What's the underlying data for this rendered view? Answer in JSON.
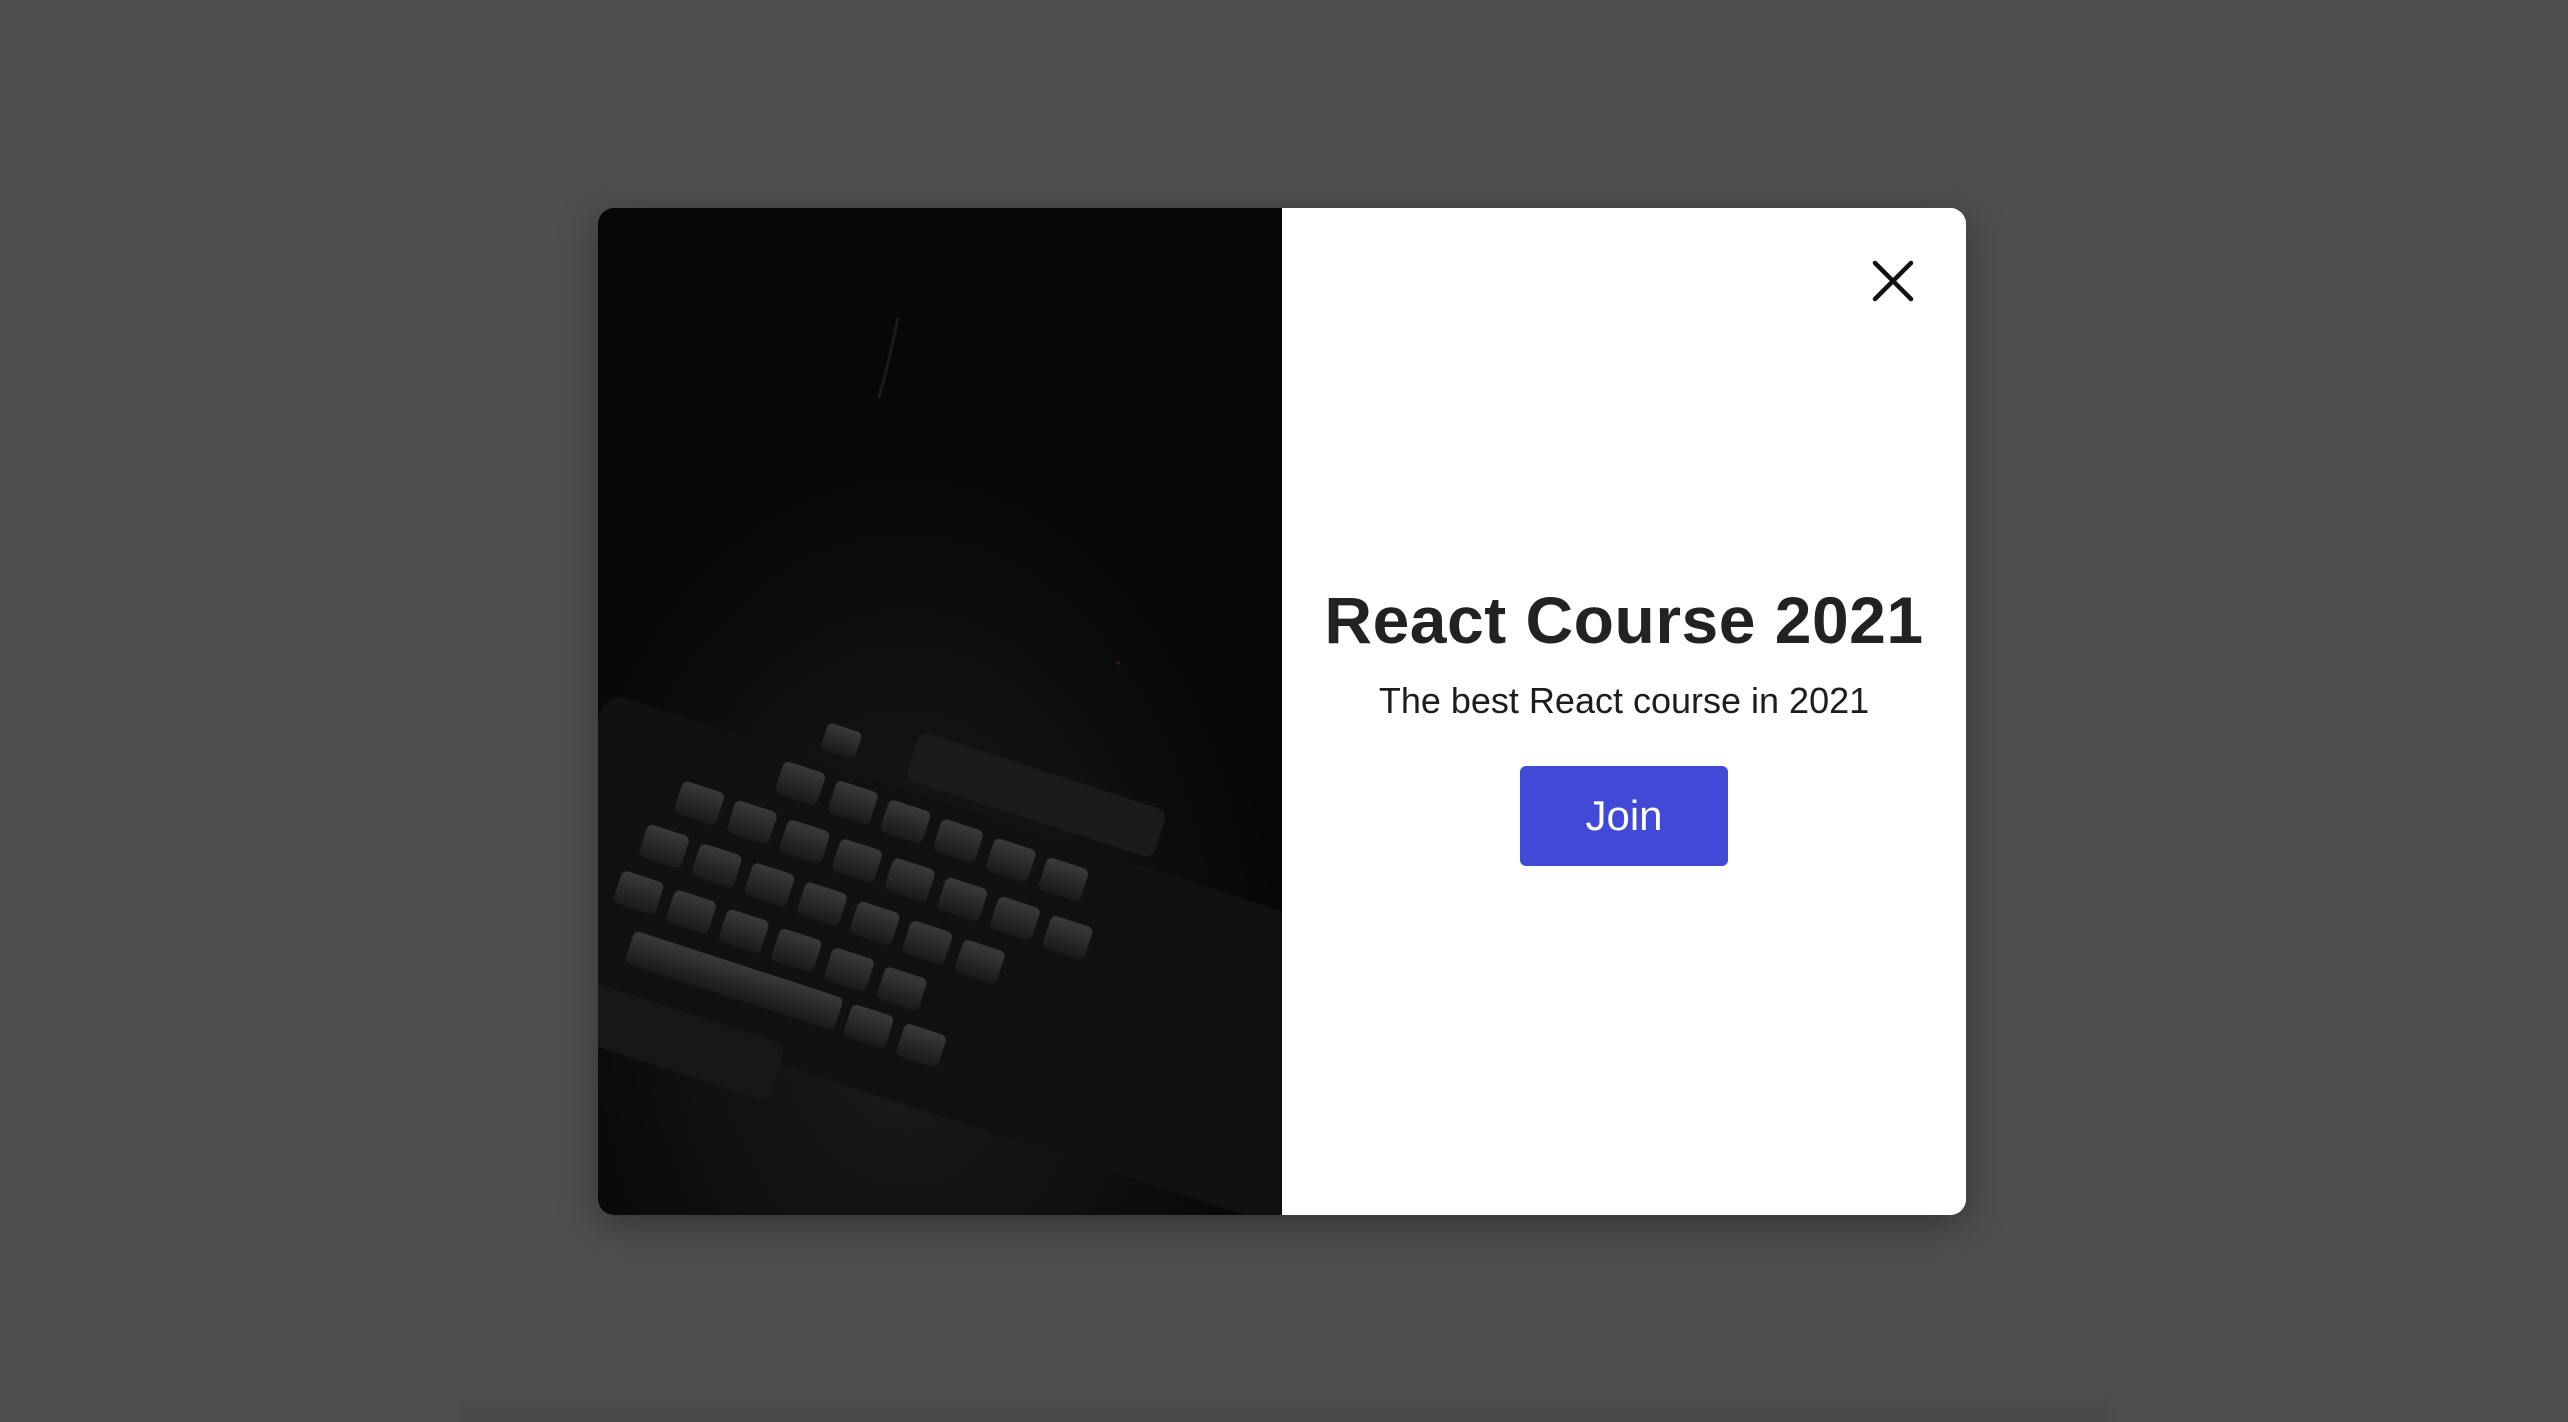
{
  "modal": {
    "title": "React Course 2021",
    "subtitle": "The best React course in 2021",
    "join_label": "Join",
    "close_icon": "close-icon",
    "image_description_icon": "keyboard-image"
  },
  "colors": {
    "overlay": "#4f4f4f",
    "image_bg": "#070707",
    "content_bg": "#ffffff",
    "accent": "#4149d6",
    "title": "#222222"
  }
}
